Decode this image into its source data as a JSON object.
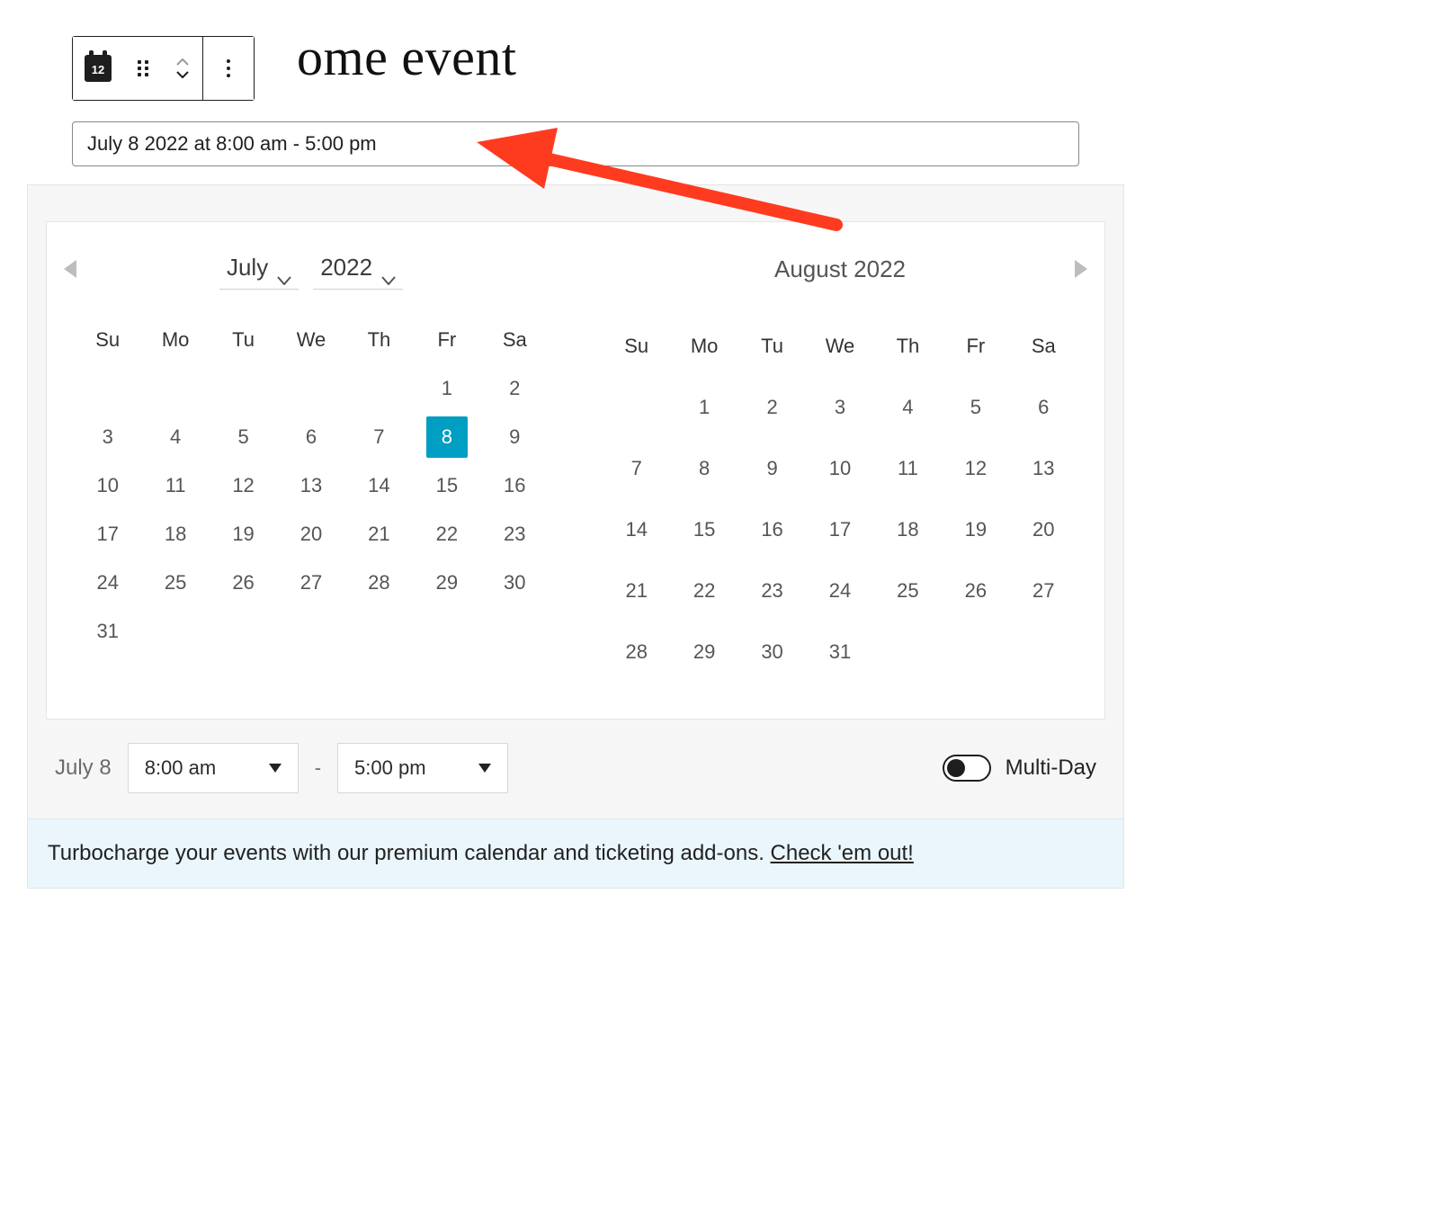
{
  "toolbar": {
    "block_icon_day": "12"
  },
  "title_fragment": "ome event",
  "date_input": "July 8 2022 at 8:00 am - 5:00 pm",
  "picker": {
    "left": {
      "month": "July",
      "year": "2022",
      "dow": [
        "Su",
        "Mo",
        "Tu",
        "We",
        "Th",
        "Fr",
        "Sa"
      ],
      "weeks": [
        [
          "",
          "",
          "",
          "",
          "",
          "1",
          "2"
        ],
        [
          "3",
          "4",
          "5",
          "6",
          "7",
          "8",
          "9"
        ],
        [
          "10",
          "11",
          "12",
          "13",
          "14",
          "15",
          "16"
        ],
        [
          "17",
          "18",
          "19",
          "20",
          "21",
          "22",
          "23"
        ],
        [
          "24",
          "25",
          "26",
          "27",
          "28",
          "29",
          "30"
        ],
        [
          "31",
          "",
          "",
          "",
          "",
          "",
          ""
        ]
      ],
      "selected_day": "8"
    },
    "right": {
      "title": "August 2022",
      "dow": [
        "Su",
        "Mo",
        "Tu",
        "We",
        "Th",
        "Fr",
        "Sa"
      ],
      "weeks": [
        [
          "",
          "1",
          "2",
          "3",
          "4",
          "5",
          "6"
        ],
        [
          "7",
          "8",
          "9",
          "10",
          "11",
          "12",
          "13"
        ],
        [
          "14",
          "15",
          "16",
          "17",
          "18",
          "19",
          "20"
        ],
        [
          "21",
          "22",
          "23",
          "24",
          "25",
          "26",
          "27"
        ],
        [
          "28",
          "29",
          "30",
          "31",
          "",
          "",
          ""
        ]
      ]
    }
  },
  "time": {
    "date_label": "July 8",
    "start": "8:00 am",
    "end": "5:00 pm",
    "separator": "-",
    "multi_label": "Multi-Day",
    "multi_on": false
  },
  "promo": {
    "text": "Turbocharge your events with our premium calendar and ticketing add-ons. ",
    "link": "Check 'em out!"
  }
}
